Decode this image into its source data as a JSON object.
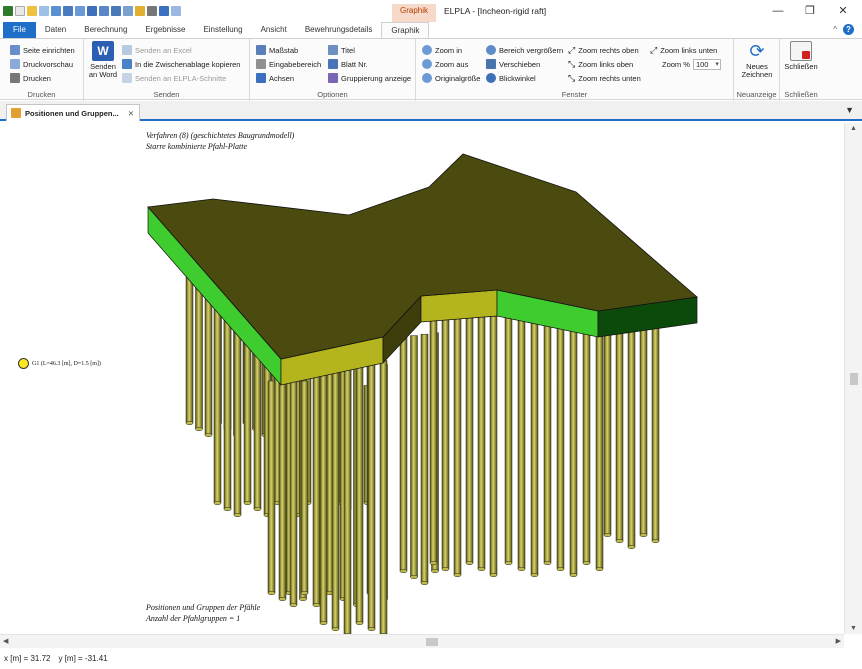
{
  "window": {
    "title": "ELPLA - [Incheon-rigid raft]",
    "context_tab_label": "Graphik",
    "controls": {
      "minimize": "—",
      "restore": "❐",
      "close": "✕"
    }
  },
  "tabs": [
    "File",
    "Daten",
    "Berechnung",
    "Ergebnisse",
    "Einstellung",
    "Ansicht",
    "Bewehrungsdetails",
    "Graphik"
  ],
  "ribbon": {
    "drucken": {
      "label": "Drucken",
      "items": [
        "Seite einrichten",
        "Druckvorschau",
        "Drucken"
      ]
    },
    "senden": {
      "label": "Senden",
      "word_button": "Senden an Word",
      "items": [
        "Senden an Excel",
        "In die Zwischenablage kopieren",
        "Senden an ELPLA-Schnitte"
      ]
    },
    "optionen": {
      "label": "Optionen",
      "items": [
        "Maßstab",
        "Eingabebereich",
        "Achsen",
        "Titel",
        "Blatt Nr.",
        "Gruppierung anzeige"
      ]
    },
    "fenster": {
      "label": "Fenster",
      "items": [
        "Zoom in",
        "Zoom aus",
        "Originalgröße",
        "Bereich vergrößern",
        "Verschieben",
        "Blickwinkel",
        "Zoom rechts oben",
        "Zoom links oben",
        "Zoom rechts unten",
        "Zoom links unten"
      ],
      "zoom_label": "Zoom %",
      "zoom_value": "100"
    },
    "neuanzeige": {
      "label": "Neuanzeige",
      "button": "Neues Zeichnen"
    },
    "schliessen": {
      "label": "Schließen",
      "button": "Schließen"
    }
  },
  "document_tab": {
    "label": "Positionen und Gruppen...",
    "close": "✕"
  },
  "canvas": {
    "header_line1": "Verfahren (8) (geschichtetes Baugrundmodell)",
    "header_line2": "Starre kombinierte Pfahl-Platte",
    "footer_line1": "Positionen und Gruppen der Pfähle",
    "footer_line2": "Anzahl der Pfahlgruppen = 1",
    "legend_text": "G1 (L=46.3 [m], D=1.5 [m])",
    "colors": {
      "raft_top": "#4b4a0f",
      "raft_side_green": "#3fcc2f",
      "raft_side_dark": "#0c4a0c",
      "raft_side_yellow": "#b4b41e",
      "raft_side_olive": "#3e3d0c",
      "pile_light": "#d8d46a",
      "pile_dark": "#55530e"
    }
  },
  "status": {
    "x": "x [m] = 31.72",
    "y": "y [m] = -31.41"
  }
}
